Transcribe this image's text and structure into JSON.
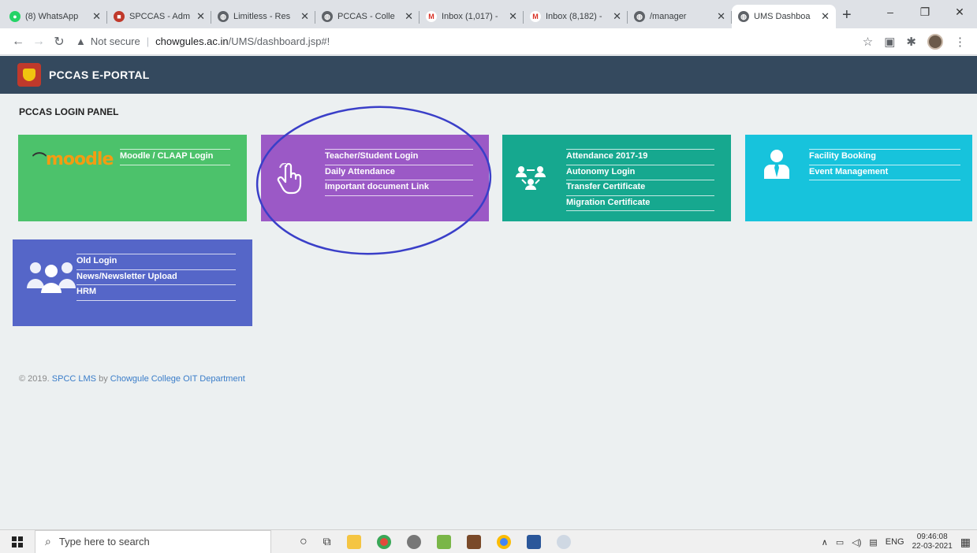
{
  "browser": {
    "tabs": [
      {
        "title": "(8) WhatsApp",
        "favicon_color": "#25d366",
        "favicon_glyph": "●"
      },
      {
        "title": "SPCCAS - Adm",
        "favicon_color": "#c0392b",
        "favicon_glyph": "■"
      },
      {
        "title": "Limitless - Res",
        "favicon_color": "#5f6368",
        "favicon_glyph": "◍"
      },
      {
        "title": "PCCAS - Colle",
        "favicon_color": "#5f6368",
        "favicon_glyph": "◍"
      },
      {
        "title": "Inbox (1,017) -",
        "favicon_color": "#ffffff",
        "favicon_glyph": "M"
      },
      {
        "title": "Inbox (8,182) -",
        "favicon_color": "#ffffff",
        "favicon_glyph": "M"
      },
      {
        "title": "/manager",
        "favicon_color": "#5f6368",
        "favicon_glyph": "◍"
      },
      {
        "title": "UMS Dashboa",
        "favicon_color": "#5f6368",
        "favicon_glyph": "◍"
      }
    ],
    "address": {
      "security": "Not secure",
      "host": "chowgules.ac.in",
      "path": "/UMS/dashboard.jsp#!"
    }
  },
  "app": {
    "brand": "PCCAS E-PORTAL",
    "panel_title": "PCCAS LOGIN PANEL",
    "tiles": [
      {
        "id": "moodle",
        "color": "#4cc26b",
        "icon": "moodle-logo",
        "icon_text": "moodle",
        "links": [
          "Moodle / CLAAP Login"
        ]
      },
      {
        "id": "teacher",
        "color": "#9b59c6",
        "icon": "hand-pointer-icon",
        "links": [
          "Teacher/Student Login",
          "Daily Attendance",
          "Important document Link"
        ]
      },
      {
        "id": "attendance",
        "color": "#16a88f",
        "icon": "users-network-icon",
        "links": [
          "Attendance 2017-19",
          "Autonomy Login",
          "Transfer Certificate",
          "Migration Certificate"
        ]
      },
      {
        "id": "facility",
        "color": "#17c3dc",
        "icon": "user-tie-icon",
        "links": [
          "Facility Booking",
          "Event Management"
        ]
      },
      {
        "id": "old",
        "color": "#5566c8",
        "icon": "users-group-icon",
        "links": [
          "Old Login",
          "News/Newsletter Upload",
          "HRM"
        ]
      }
    ],
    "footer": {
      "prefix": "© 2019.",
      "lms": "SPCC LMS",
      "by": "by",
      "dept": "Chowgule College OIT Department"
    },
    "annotation_color": "#3a3fc8"
  },
  "taskbar": {
    "search_placeholder": "Type here to search",
    "lang": "ENG",
    "time": "09:46:08",
    "date": "22-03-2021"
  }
}
